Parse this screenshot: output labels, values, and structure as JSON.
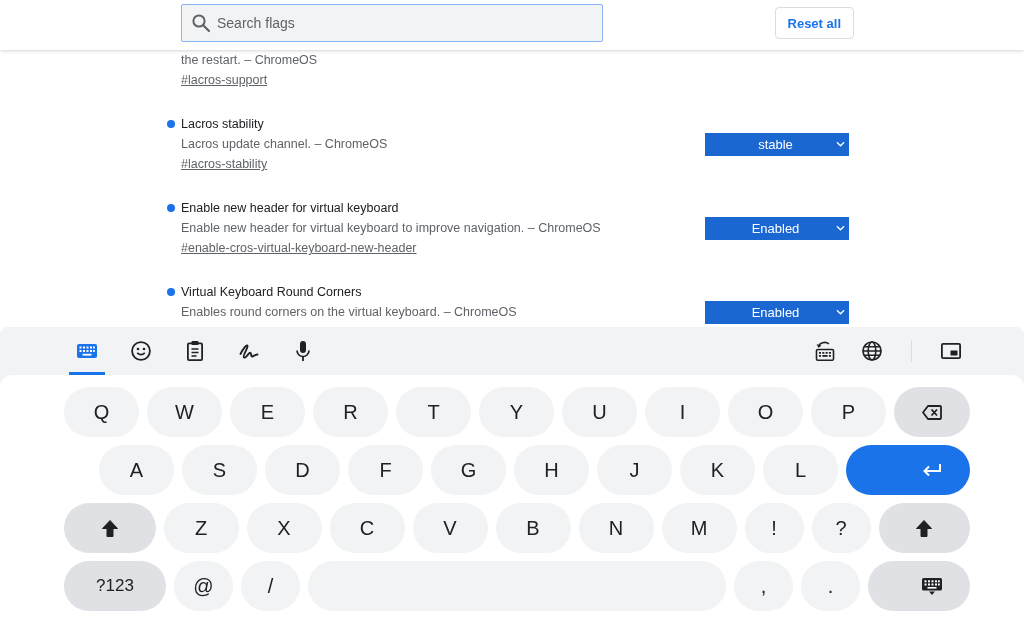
{
  "header": {
    "search": {
      "placeholder": "Search flags"
    },
    "reset_button": "Reset all"
  },
  "partial_flag": {
    "description": "the restart. – ChromeOS",
    "link": "#lacros-support"
  },
  "flags": [
    {
      "title": "Lacros stability",
      "modified": true,
      "description": "Lacros update channel. – ChromeOS",
      "link": "#lacros-stability",
      "value": "stable"
    },
    {
      "title": "Enable new header for virtual keyboard",
      "modified": true,
      "description": "Enable new header for virtual keyboard to improve navigation. – ChromeOS",
      "link": "#enable-cros-virtual-keyboard-new-header",
      "value": "Enabled"
    },
    {
      "title": "Virtual Keyboard Round Corners",
      "modified": true,
      "description": "Enables round corners on the virtual keyboard. – ChromeOS",
      "value": "Enabled"
    }
  ],
  "keyboard": {
    "tabs": [
      {
        "kind": "keyboard",
        "selected": true
      },
      {
        "kind": "emoji",
        "selected": false
      },
      {
        "kind": "clipboard",
        "selected": false
      },
      {
        "kind": "handwriting",
        "selected": false
      },
      {
        "kind": "voice",
        "selected": false
      }
    ],
    "tools": [
      {
        "kind": "layout"
      },
      {
        "kind": "language"
      },
      {
        "kind": "float"
      }
    ],
    "rows": [
      [
        {
          "kind": "letter",
          "label": "Q"
        },
        {
          "kind": "letter",
          "label": "W"
        },
        {
          "kind": "letter",
          "label": "E"
        },
        {
          "kind": "letter",
          "label": "R"
        },
        {
          "kind": "letter",
          "label": "T"
        },
        {
          "kind": "letter",
          "label": "Y"
        },
        {
          "kind": "letter",
          "label": "U"
        },
        {
          "kind": "letter",
          "label": "I"
        },
        {
          "kind": "letter",
          "label": "O"
        },
        {
          "kind": "letter",
          "label": "P"
        },
        {
          "kind": "backspace"
        }
      ],
      [
        {
          "kind": "letter",
          "label": "A"
        },
        {
          "kind": "letter",
          "label": "S"
        },
        {
          "kind": "letter",
          "label": "D"
        },
        {
          "kind": "letter",
          "label": "F"
        },
        {
          "kind": "letter",
          "label": "G"
        },
        {
          "kind": "letter",
          "label": "H"
        },
        {
          "kind": "letter",
          "label": "J"
        },
        {
          "kind": "letter",
          "label": "K"
        },
        {
          "kind": "letter",
          "label": "L"
        },
        {
          "kind": "enter"
        }
      ],
      [
        {
          "kind": "shift"
        },
        {
          "kind": "letter",
          "label": "Z"
        },
        {
          "kind": "letter",
          "label": "X"
        },
        {
          "kind": "letter",
          "label": "C"
        },
        {
          "kind": "letter",
          "label": "V"
        },
        {
          "kind": "letter",
          "label": "B"
        },
        {
          "kind": "letter",
          "label": "N"
        },
        {
          "kind": "letter",
          "label": "M"
        },
        {
          "kind": "punct",
          "label": "!"
        },
        {
          "kind": "punct",
          "label": "?"
        },
        {
          "kind": "shift"
        }
      ],
      [
        {
          "kind": "symbols",
          "label": "?123"
        },
        {
          "kind": "punct",
          "label": "@"
        },
        {
          "kind": "punct",
          "label": "/"
        },
        {
          "kind": "space"
        },
        {
          "kind": "punct",
          "label": ","
        },
        {
          "kind": "punct",
          "label": "."
        },
        {
          "kind": "hide"
        }
      ]
    ]
  }
}
